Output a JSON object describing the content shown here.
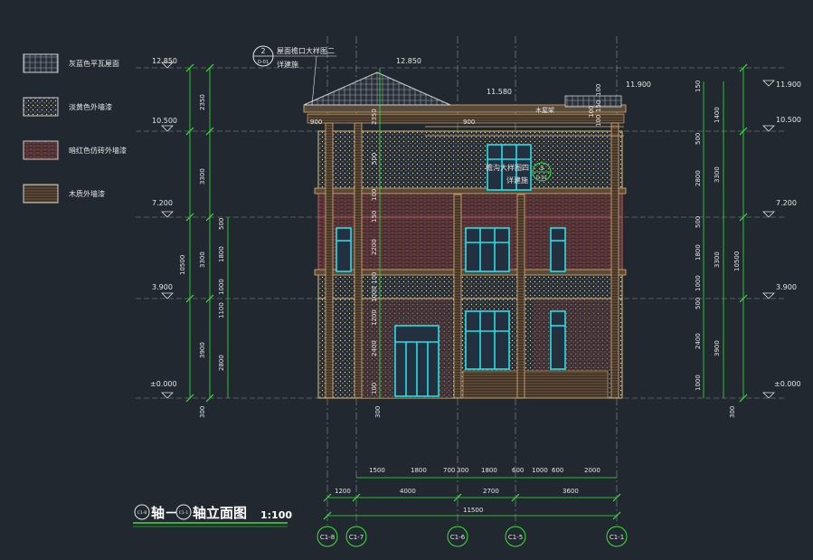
{
  "legend": [
    {
      "label": "灰蓝色平瓦屋面",
      "swatch": "roof"
    },
    {
      "label": "淡黄色外墙漆",
      "swatch": "yellow"
    },
    {
      "label": "暗红色仿砖外墙漆",
      "swatch": "brick"
    },
    {
      "label": "木质外墙漆",
      "swatch": "wood"
    }
  ],
  "title": {
    "axis_from": "C1-8",
    "connector": "轴－",
    "axis_to": "C1-1",
    "suffix": "轴立面图",
    "scale": "1:100"
  },
  "notes": {
    "detail_ref_top": {
      "num": "2",
      "sheet": "D-01",
      "line1": "屋面檐口大样图二",
      "line2": "详建施"
    },
    "detail_ref_mid": {
      "num": "3",
      "sheet": "D-01",
      "line1": "檐沟大样图四",
      "line2": "详建施"
    },
    "roof_note": "木屋架"
  },
  "elevations_left": [
    "12.850",
    "10.500",
    "7.200",
    "3.900",
    "±0.000"
  ],
  "elevations_right": [
    "11.900",
    "10.500",
    "7.200",
    "3.900",
    "±0.000"
  ],
  "elevations_top": [
    "12.850",
    "11.580",
    "11.900"
  ],
  "dims_left_outer": [
    "2350",
    "3300",
    "3300",
    "3900"
  ],
  "dims_left_total": "10500",
  "dims_left_inner": [
    "500",
    "1800",
    "1000",
    "1100",
    "2800"
  ],
  "dims_center": [
    "2350",
    "500",
    "100",
    "150",
    "2200",
    "100",
    "1000",
    "1200",
    "2400",
    "100"
  ],
  "dims_right_outer": [
    "1400",
    "3300",
    "3300",
    "3900"
  ],
  "dims_right_total": "10500",
  "dims_right_inner": [
    "150",
    "500",
    "2800",
    "500",
    "1800",
    "1000",
    "500",
    "2400",
    "1000"
  ],
  "dims_small_top": [
    "100",
    "150",
    "100",
    "100"
  ],
  "dims_bottom_extra": [
    "300",
    "300",
    "300"
  ],
  "dims_row1": [
    "1500",
    "1800",
    "700",
    "300",
    "1800",
    "600",
    "1000",
    "600",
    "2000"
  ],
  "dims_row2": [
    "1200",
    "4000",
    "2700",
    "3600"
  ],
  "dims_total": "11500",
  "eave_dims": [
    "900",
    "900"
  ],
  "axes": [
    "C1-8",
    "C1-7",
    "C1-6",
    "C1-5",
    "C1-1"
  ]
}
